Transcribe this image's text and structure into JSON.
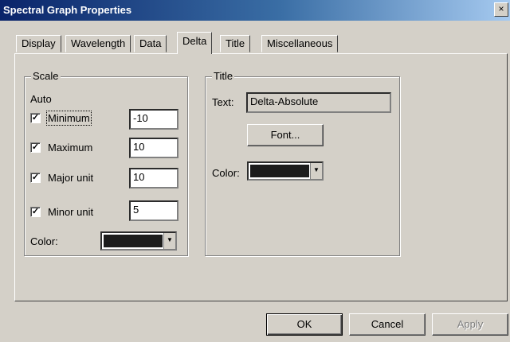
{
  "window": {
    "title": "Spectral Graph Properties",
    "close_glyph": "×"
  },
  "tabs": [
    {
      "label": "Display"
    },
    {
      "label": "Wavelength"
    },
    {
      "label": "Data"
    },
    {
      "label": "Delta",
      "active": true
    },
    {
      "label": "Title"
    },
    {
      "label": "Miscellaneous"
    }
  ],
  "scale": {
    "group_label": "Scale",
    "auto_label": "Auto",
    "minimum": {
      "label": "Minimum",
      "checked": true,
      "value": "-10"
    },
    "maximum": {
      "label": "Maximum",
      "checked": true,
      "value": "10"
    },
    "major_unit": {
      "label": "Major unit",
      "checked": true,
      "value": "10"
    },
    "minor_unit": {
      "label": "Minor unit",
      "checked": true,
      "value": "5"
    },
    "color_label": "Color:",
    "color_value": "#1c1c1c"
  },
  "title_group": {
    "group_label": "Title",
    "text_label": "Text:",
    "text_value": "Delta-Absolute",
    "font_button": "Font...",
    "color_label": "Color:",
    "color_value": "#1c1c1c"
  },
  "footer": {
    "ok": "OK",
    "cancel": "Cancel",
    "apply": "Apply"
  },
  "check_glyph": "✓",
  "dropdown_glyph": "▼"
}
